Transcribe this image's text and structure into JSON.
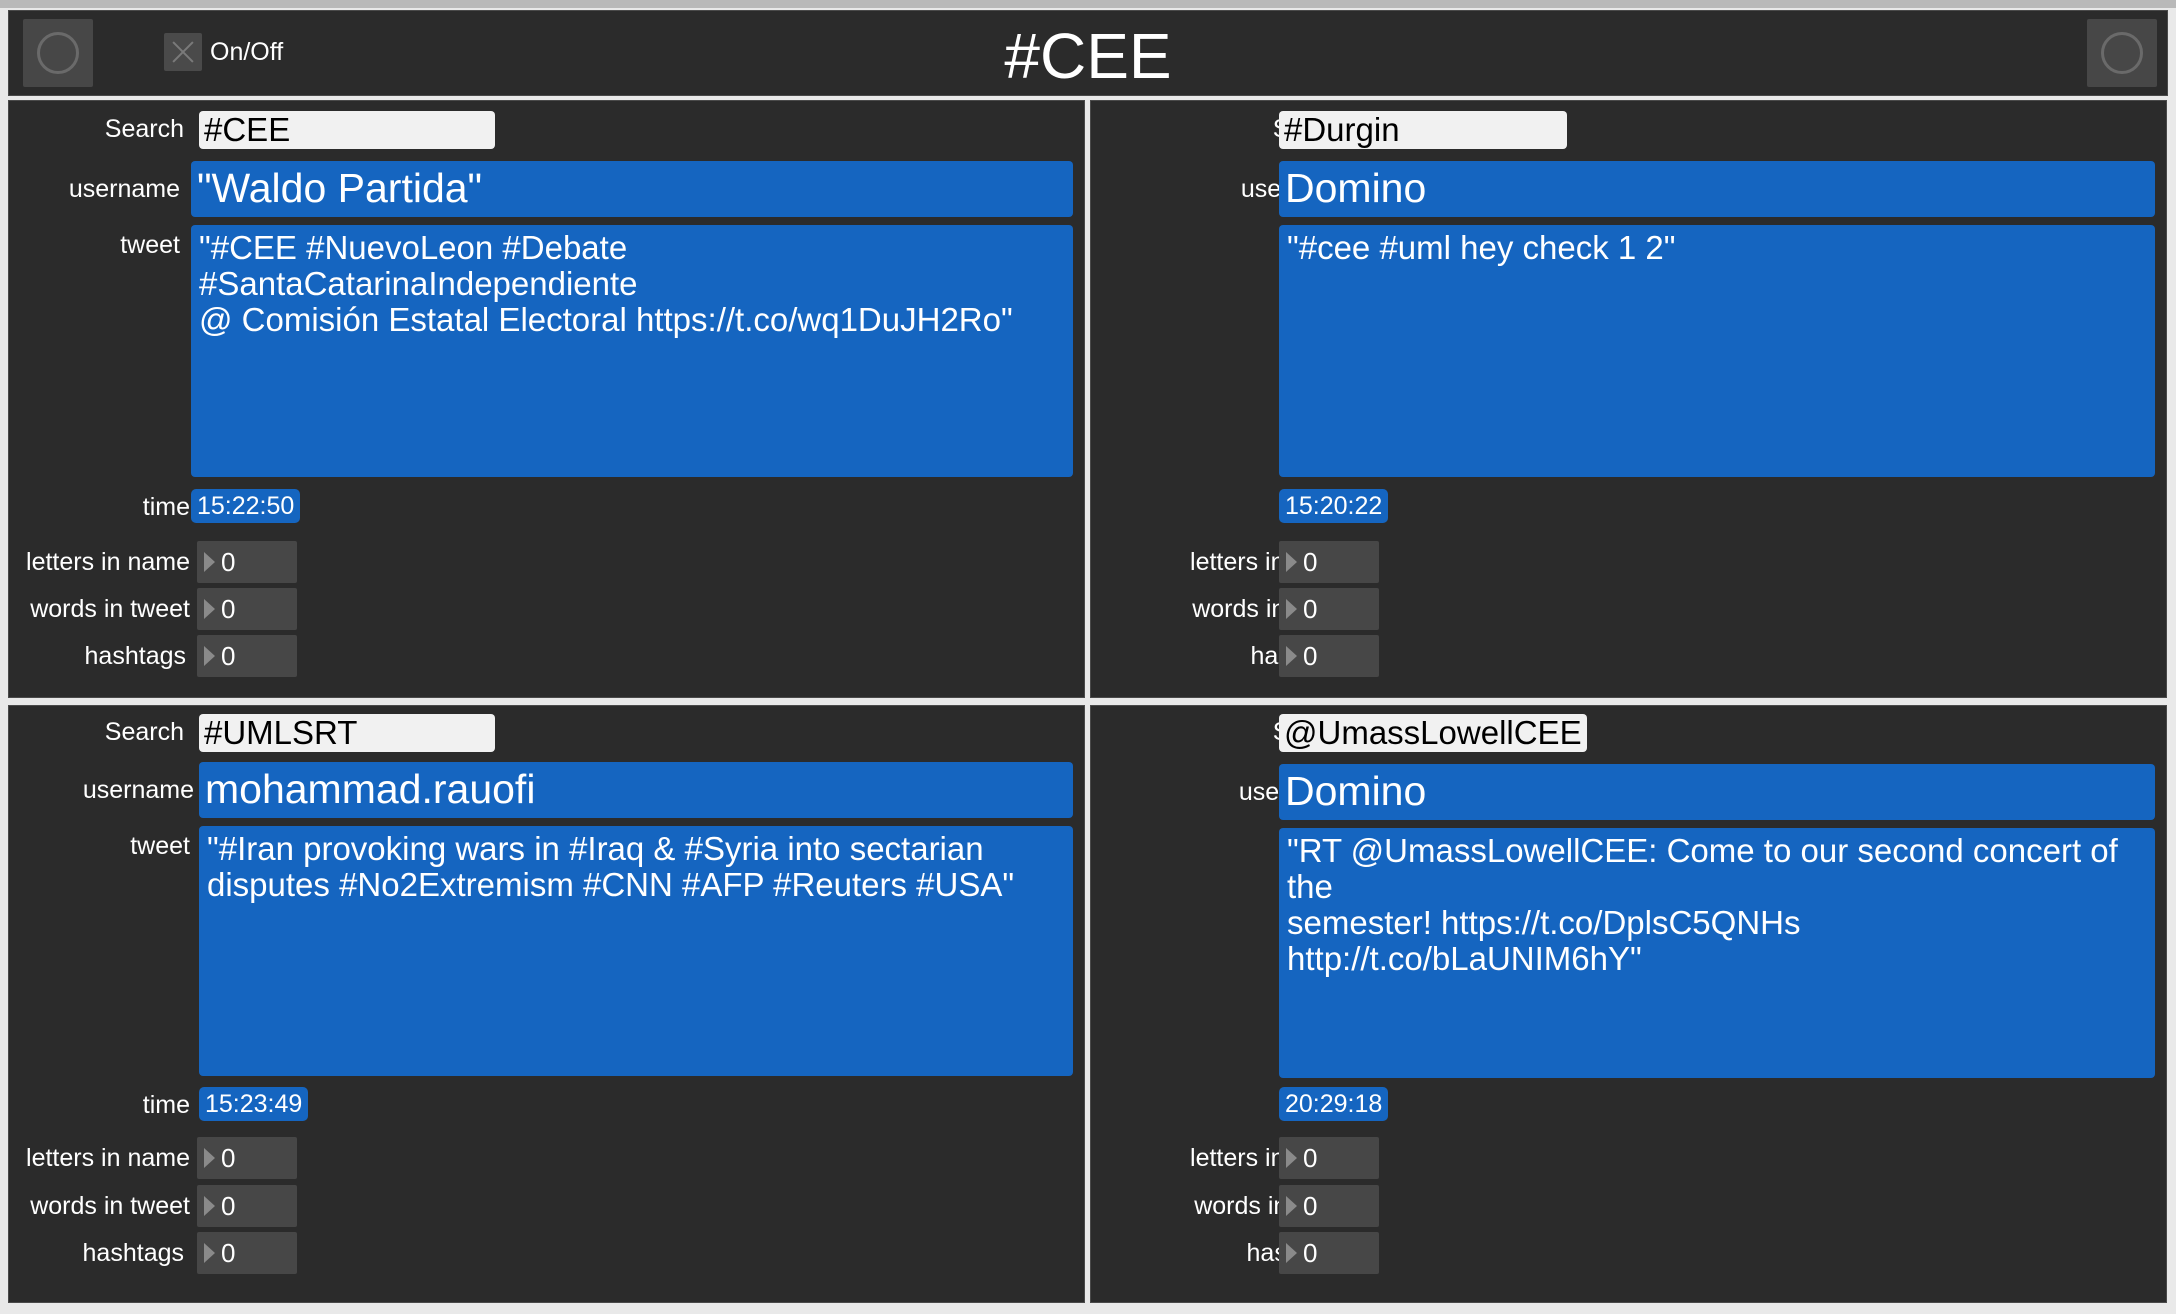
{
  "app": {
    "title": "#CEE",
    "toggle_label": "On/Off"
  },
  "labels": {
    "search": "Search",
    "username": "username",
    "tweet": "tweet",
    "time": "time",
    "letters_in_name": "letters in name",
    "words_in_tweet": "words in tweet",
    "hashtags": "hashtags"
  },
  "panels": [
    {
      "search": "#CEE",
      "username": "\"Waldo Partida\"",
      "tweet": "\"#CEE #NuevoLeon #Debate #SantaCatarinaIndependiente\n@ Comisión Estatal Electoral https://t.co/wq1DuJH2Ro\"",
      "time": "15:22:50",
      "letters_in_name": "0",
      "words_in_tweet": "0",
      "hashtags": "0"
    },
    {
      "search": "#Durgin",
      "username": "Domino",
      "tweet": "\"#cee #uml hey check 1 2\"",
      "time": "15:20:22",
      "letters_in_name": "0",
      "words_in_tweet": "0",
      "hashtags": "0"
    },
    {
      "search": "#UMLSRT",
      "username": "mohammad.rauofi",
      "tweet": "\"#Iran provoking wars in #Iraq & #Syria into sectarian\ndisputes #No2Extremism #CNN #AFP #Reuters #USA\"",
      "time": "15:23:49",
      "letters_in_name": "0",
      "words_in_tweet": "0",
      "hashtags": "0"
    },
    {
      "search": "@UmassLowellCEE",
      "username": "Domino",
      "tweet": "\"RT @UmassLowellCEE: Come to our second concert of the\nsemester! https://t.co/DplsC5QNHs http://t.co/bLaUNIM6hY\"",
      "time": "20:29:18",
      "letters_in_name": "0",
      "words_in_tweet": "0",
      "hashtags": "0"
    }
  ]
}
